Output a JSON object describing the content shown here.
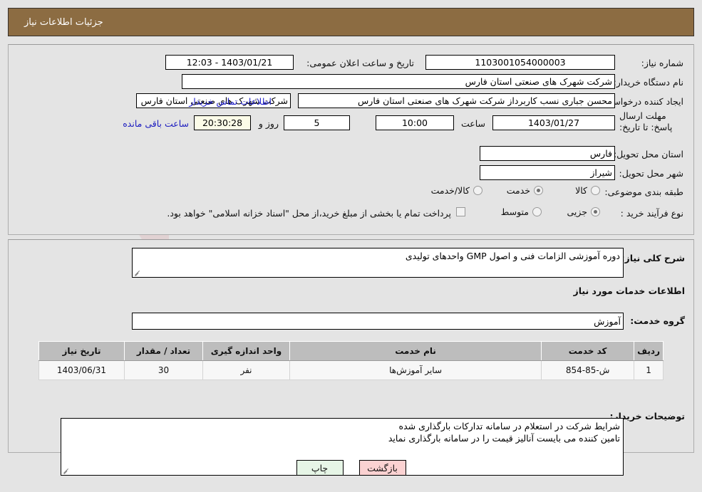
{
  "window": {
    "title": "جزئیات اطلاعات نیاز",
    "header_bg": "#8c6c42"
  },
  "watermark": {
    "text": "AnaTender.net"
  },
  "request": {
    "need_number_label": "شماره نیاز:",
    "need_number_value": "1103001054000003",
    "announce_datetime_label": "تاریخ و ساعت اعلان عمومی:",
    "announce_datetime_value": "1403/01/21 - 12:03",
    "buyer_org_label": "نام دستگاه خریدار:",
    "buyer_org_value": "شرکت شهرک های صنعتی استان فارس",
    "creator_label": "ایجاد کننده درخواست:",
    "creator_value": "محسن  جباری نسب کاربرداز شرکت شهرک های صنعتی استان فارس",
    "buyer_org_secondary_value": "شرکت شهرک های صنعتی استان فارس",
    "contact_link": "اطلاعات تماس خریدار",
    "deadline_label": "مهلت ارسال پاسخ: تا تاریخ:",
    "deadline_date": "1403/01/27",
    "deadline_hour_label": "ساعت",
    "deadline_hour_value": "10:00",
    "remaining_days_value": "5",
    "remaining_days_label": "روز و",
    "remaining_time_value": "20:30:28",
    "remaining_time_label": "ساعت باقی مانده",
    "province_label": "استان محل تحویل:",
    "province_value": "فارس",
    "city_label": "شهر محل تحویل:",
    "city_value": "شیراز"
  },
  "classification": {
    "label": "طبقه بندی موضوعی:",
    "options": [
      {
        "label": "کالا",
        "selected": false
      },
      {
        "label": "خدمت",
        "selected": true
      },
      {
        "label": "کالا/خدمت",
        "selected": false
      }
    ]
  },
  "purchase_type": {
    "label": "نوع فرآیند خرید :",
    "options": [
      {
        "label": "جزیی",
        "selected": true
      },
      {
        "label": "متوسط",
        "selected": false
      }
    ],
    "treasury_checkbox_checked": false,
    "treasury_note": "پرداخت تمام یا بخشی از مبلغ خرید،از محل \"اسناد خزانه اسلامی\" خواهد بود."
  },
  "description": {
    "label": "شرح کلی نیاز:",
    "value": "دوره آموزشی الزامات فنی و اصول GMP واحدهای تولیدی"
  },
  "services_section": {
    "heading": "اطلاعات خدمات مورد نیاز",
    "group_label": "گروه خدمت:",
    "group_value": "آموزش"
  },
  "table": {
    "columns": [
      "ردیف",
      "کد خدمت",
      "نام خدمت",
      "واحد اندازه گیری",
      "تعداد / مقدار",
      "تاریخ نیاز"
    ],
    "rows": [
      {
        "row_no": "1",
        "service_code": "ش-85-854",
        "service_name": "سایر آموزش‌ها",
        "unit": "نفر",
        "quantity": "30",
        "need_date": "1403/06/31"
      }
    ]
  },
  "buyer_notes": {
    "label": "توضیحات خریدار:",
    "line1": "شرایط شرکت در استعلام در سامانه تدارکات بارگذاری شده",
    "line2": "تامین کننده می بایست آنالیز قیمت را در سامانه بارگذاری نماید"
  },
  "footer": {
    "print_label": "چاپ",
    "back_label": "بازگشت"
  }
}
